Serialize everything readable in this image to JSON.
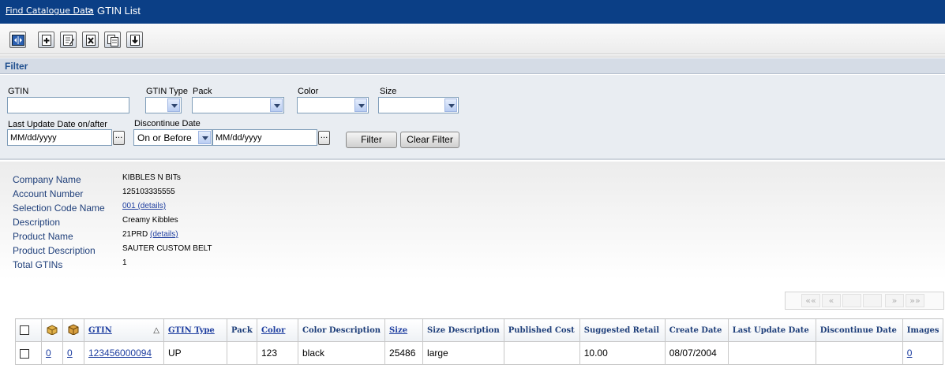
{
  "breadcrumb": {
    "link": "Find Catalogue Data",
    "separator": ">",
    "current": "GTIN List"
  },
  "toolbar": {
    "icons": [
      "toggle-panel-icon",
      "add-icon",
      "edit-icon",
      "delete-icon",
      "copy-icon",
      "export-icon"
    ]
  },
  "filter": {
    "title": "Filter",
    "gtin_label": "GTIN",
    "gtin_value": "",
    "gtin_type_label": "GTIN Type",
    "gtin_type_value": "",
    "pack_label": "Pack",
    "pack_value": "",
    "color_label": "Color",
    "color_value": "",
    "size_label": "Size",
    "size_value": "",
    "last_update_label": "Last Update Date on/after",
    "last_update_value": "MM/dd/yyyy",
    "discontinue_label": "Discontinue Date",
    "discontinue_op": "On or Before",
    "discontinue_value": "MM/dd/yyyy",
    "browse": "...",
    "filter_button": "Filter",
    "clear_button": "Clear Filter"
  },
  "info": {
    "company_name_label": "Company Name",
    "company_name": "KIBBLES N BITs",
    "account_number_label": "Account Number",
    "account_number": "125103335555",
    "selection_code_label": "Selection Code Name",
    "selection_code": "001 (details)",
    "description_label": "Description",
    "description": "Creamy Kibbles",
    "product_name_label": "Product Name",
    "product_name": "21PRD",
    "product_details": "(details)",
    "product_description_label": "Product Description",
    "product_description": "SAUTER CUSTOM BELT",
    "total_gtins_label": "Total GTINs",
    "total_gtins": "1"
  },
  "pager": {
    "first": "««",
    "prev": "«",
    "next": "»",
    "last": "»»"
  },
  "table": {
    "headers": {
      "gtin": "GTIN",
      "sort_indicator": "△",
      "gtin_type": "GTIN Type",
      "pack": "Pack",
      "color": "Color",
      "color_description": "Color Description",
      "size": "Size",
      "size_description": "Size Description",
      "published_cost": "Published Cost",
      "suggested_retail": "Suggested Retail",
      "create_date": "Create Date",
      "last_update_date": "Last Update Date",
      "discontinue_date": "Discontinue Date",
      "images": "Images"
    },
    "rows": [
      {
        "count_a": "0",
        "count_b": "0",
        "gtin": "123456000094",
        "gtin_type": "UP",
        "pack": "",
        "color": "123",
        "color_description": "black",
        "size": "25486",
        "size_description": "large",
        "published_cost": "",
        "suggested_retail": "10.00",
        "create_date": "08/07/2004",
        "last_update_date": "",
        "discontinue_date": "",
        "images": "0"
      }
    ]
  }
}
